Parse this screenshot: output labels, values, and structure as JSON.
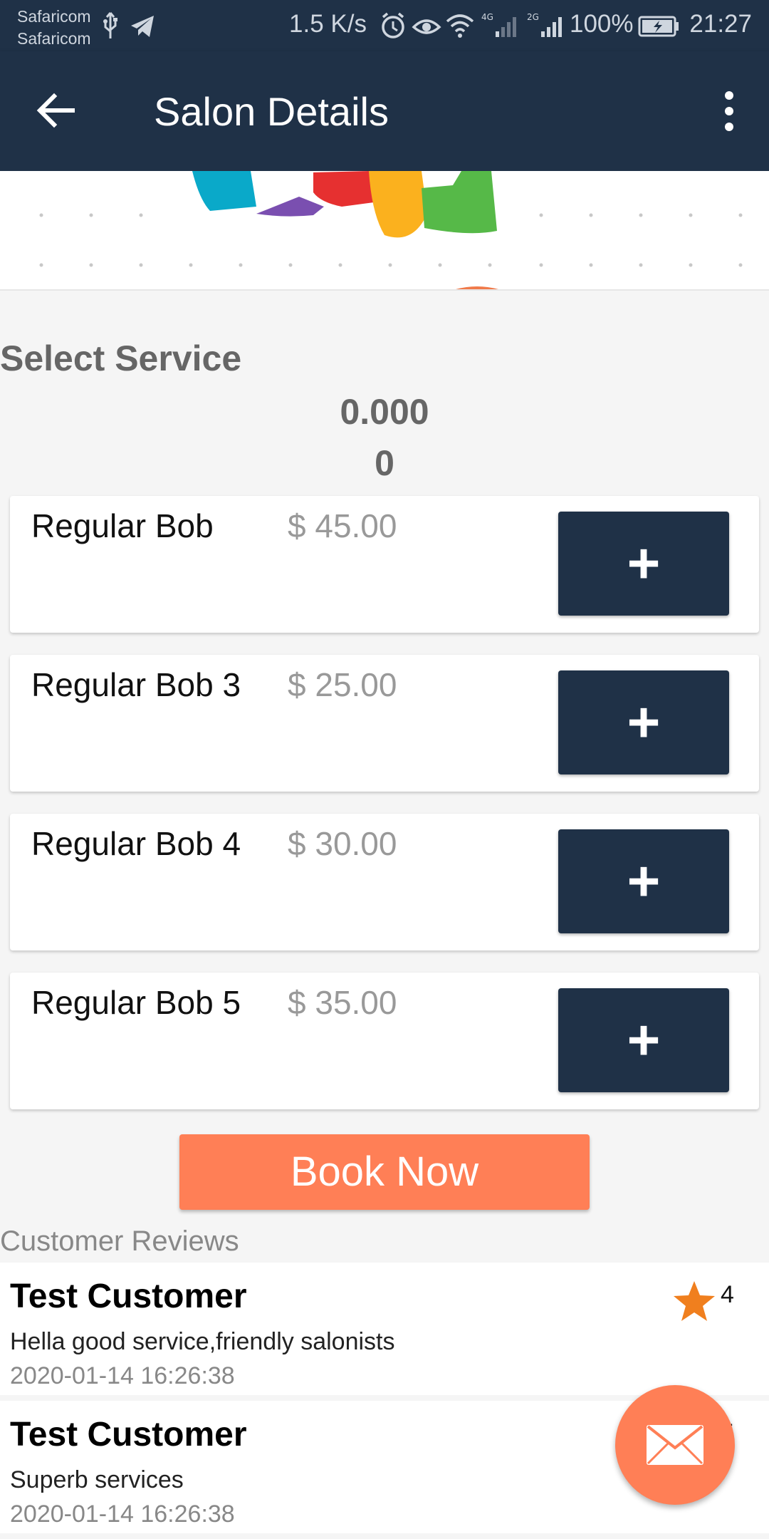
{
  "status_bar": {
    "carrier1": "Safaricom",
    "carrier2": "Safaricom",
    "speed": "1.5 K/s",
    "battery": "100%",
    "time": "21:27"
  },
  "app_bar": {
    "title": "Salon Details"
  },
  "service": {
    "section_title": "Select Service",
    "total_line1": "0.000",
    "total_line2": "0",
    "add_label": "+",
    "items": [
      {
        "name": "Regular Bob",
        "price": "$ 45.00"
      },
      {
        "name": "Regular Bob 3",
        "price": "$ 25.00"
      },
      {
        "name": "Regular Bob 4",
        "price": "$ 30.00"
      },
      {
        "name": "Regular Bob 5",
        "price": "$ 35.00"
      }
    ]
  },
  "book_button": "Book Now",
  "reviews": {
    "title": "Customer Reviews",
    "items": [
      {
        "name": "Test Customer",
        "text": "Hella good service,friendly salonists",
        "date": "2020-01-14 16:26:38",
        "rating": "4"
      },
      {
        "name": "Test Customer",
        "text": "Superb services",
        "date": "2020-01-14 16:26:38",
        "rating": "5"
      }
    ]
  },
  "colors": {
    "primary": "#1f3147",
    "accent": "#ff7f56",
    "star": "#f07f1e"
  }
}
